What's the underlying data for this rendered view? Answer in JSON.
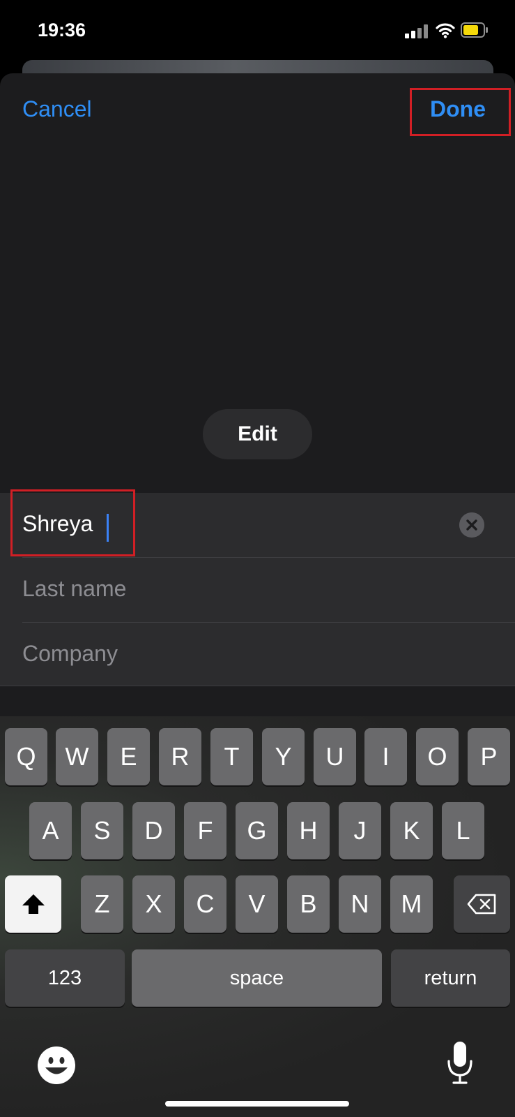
{
  "status_bar": {
    "time": "19:36"
  },
  "nav": {
    "cancel_label": "Cancel",
    "done_label": "Done"
  },
  "photo": {
    "edit_label": "Edit"
  },
  "form": {
    "first_name_value": "Shreya",
    "last_name_placeholder": "Last name",
    "company_placeholder": "Company"
  },
  "keyboard": {
    "row1": [
      "Q",
      "W",
      "E",
      "R",
      "T",
      "Y",
      "U",
      "I",
      "O",
      "P"
    ],
    "row2": [
      "A",
      "S",
      "D",
      "F",
      "G",
      "H",
      "J",
      "K",
      "L"
    ],
    "row3": [
      "Z",
      "X",
      "C",
      "V",
      "B",
      "N",
      "M"
    ],
    "numbers_label": "123",
    "space_label": "space",
    "return_label": "return"
  },
  "icons": {
    "signal": "cellular-signal-icon",
    "wifi": "wifi-icon",
    "battery": "battery-icon",
    "clear": "clear-text-icon",
    "shift": "shift-icon",
    "backspace": "backspace-icon",
    "emoji": "emoji-icon",
    "mic": "microphone-icon"
  },
  "colors": {
    "accent": "#2f8ef5",
    "highlight_box": "#d11f25",
    "battery": "#f5d90a"
  }
}
